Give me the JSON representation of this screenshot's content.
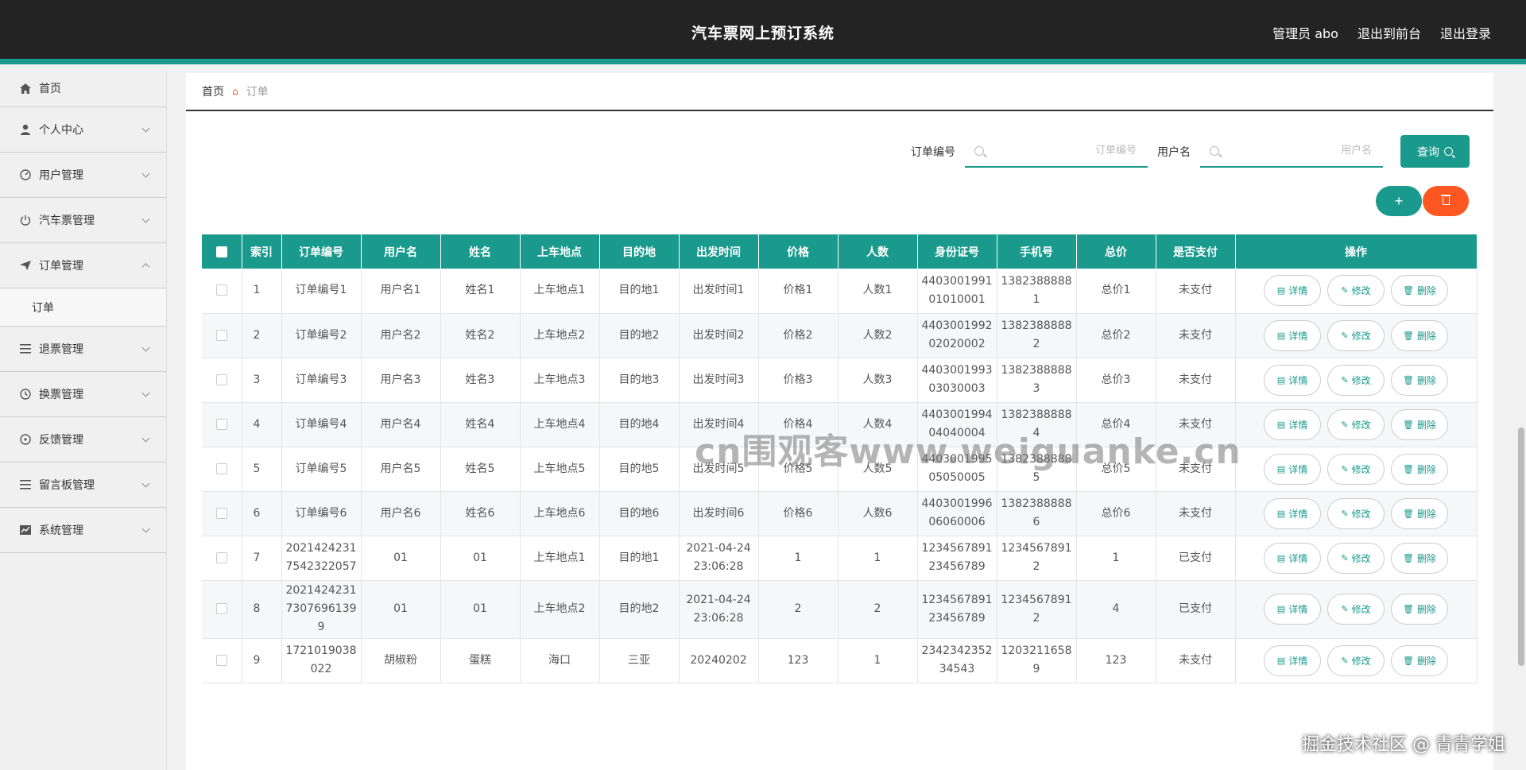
{
  "header": {
    "title": "汽车票网上预订系统",
    "admin_label": "管理员 abo",
    "to_front": "退出到前台",
    "logout": "退出登录"
  },
  "sidebar": {
    "items": [
      {
        "label": "首页",
        "icon": "home-icon"
      },
      {
        "label": "个人中心",
        "icon": "user-icon"
      },
      {
        "label": "用户管理",
        "icon": "dashboard-icon"
      },
      {
        "label": "汽车票管理",
        "icon": "power-icon"
      },
      {
        "label": "订单管理",
        "icon": "send-icon"
      },
      {
        "label": "订单",
        "icon": ""
      },
      {
        "label": "退票管理",
        "icon": "list-icon"
      },
      {
        "label": "换票管理",
        "icon": "clock-icon"
      },
      {
        "label": "反馈管理",
        "icon": "compass-icon"
      },
      {
        "label": "留言板管理",
        "icon": "list-icon"
      },
      {
        "label": "系统管理",
        "icon": "chart-icon"
      }
    ]
  },
  "breadcrumb": {
    "home": "首页",
    "current": "订单"
  },
  "search": {
    "order_label": "订单编号",
    "order_placeholder": "订单编号",
    "user_label": "用户名",
    "user_placeholder": "用户名",
    "query": "查询"
  },
  "actions": {
    "add": "+"
  },
  "table": {
    "headers": [
      "索引",
      "订单编号",
      "用户名",
      "姓名",
      "上车地点",
      "目的地",
      "出发时间",
      "价格",
      "人数",
      "身份证号",
      "手机号",
      "总价",
      "是否支付",
      "操作"
    ],
    "op_labels": {
      "detail": "详情",
      "edit": "修改",
      "delete": "删除"
    },
    "rows": [
      [
        "1",
        "订单编号1",
        "用户名1",
        "姓名1",
        "上车地点1",
        "目的地1",
        "出发时间1",
        "价格1",
        "人数1",
        "440300199101010001",
        "13823888881",
        "总价1",
        "未支付"
      ],
      [
        "2",
        "订单编号2",
        "用户名2",
        "姓名2",
        "上车地点2",
        "目的地2",
        "出发时间2",
        "价格2",
        "人数2",
        "440300199202020002",
        "13823888882",
        "总价2",
        "未支付"
      ],
      [
        "3",
        "订单编号3",
        "用户名3",
        "姓名3",
        "上车地点3",
        "目的地3",
        "出发时间3",
        "价格3",
        "人数3",
        "440300199303030003",
        "13823888883",
        "总价3",
        "未支付"
      ],
      [
        "4",
        "订单编号4",
        "用户名4",
        "姓名4",
        "上车地点4",
        "目的地4",
        "出发时间4",
        "价格4",
        "人数4",
        "440300199404040004",
        "13823888884",
        "总价4",
        "未支付"
      ],
      [
        "5",
        "订单编号5",
        "用户名5",
        "姓名5",
        "上车地点5",
        "目的地5",
        "出发时间5",
        "价格5",
        "人数5",
        "440300199505050005",
        "13823888885",
        "总价5",
        "未支付"
      ],
      [
        "6",
        "订单编号6",
        "用户名6",
        "姓名6",
        "上车地点6",
        "目的地6",
        "出发时间6",
        "价格6",
        "人数6",
        "440300199606060006",
        "13823888886",
        "总价6",
        "未支付"
      ],
      [
        "7",
        "20214242317542322057",
        "01",
        "01",
        "上车地点1",
        "目的地1",
        "2021-04-24 23:06:28",
        "1",
        "1",
        "123456789123456789",
        "12345678912",
        "1",
        "已支付"
      ],
      [
        "8",
        "202142423173076961399",
        "01",
        "01",
        "上车地点2",
        "目的地2",
        "2021-04-24 23:06:28",
        "2",
        "2",
        "123456789123456789",
        "12345678912",
        "4",
        "已支付"
      ],
      [
        "9",
        "1721019038022",
        "胡椒粉",
        "蛋糕",
        "海口",
        "三亚",
        "20240202",
        "123",
        "1",
        "234234235234543",
        "12032116589",
        "123",
        "未支付"
      ]
    ]
  },
  "watermark": "cn围观客www.weiguanke.cn",
  "corner_mark": "掘金技术社区 @ 青青学姐",
  "colors": {
    "accent": "#1a9a8c",
    "danger": "#ff5722",
    "header_bg": "#232323"
  }
}
